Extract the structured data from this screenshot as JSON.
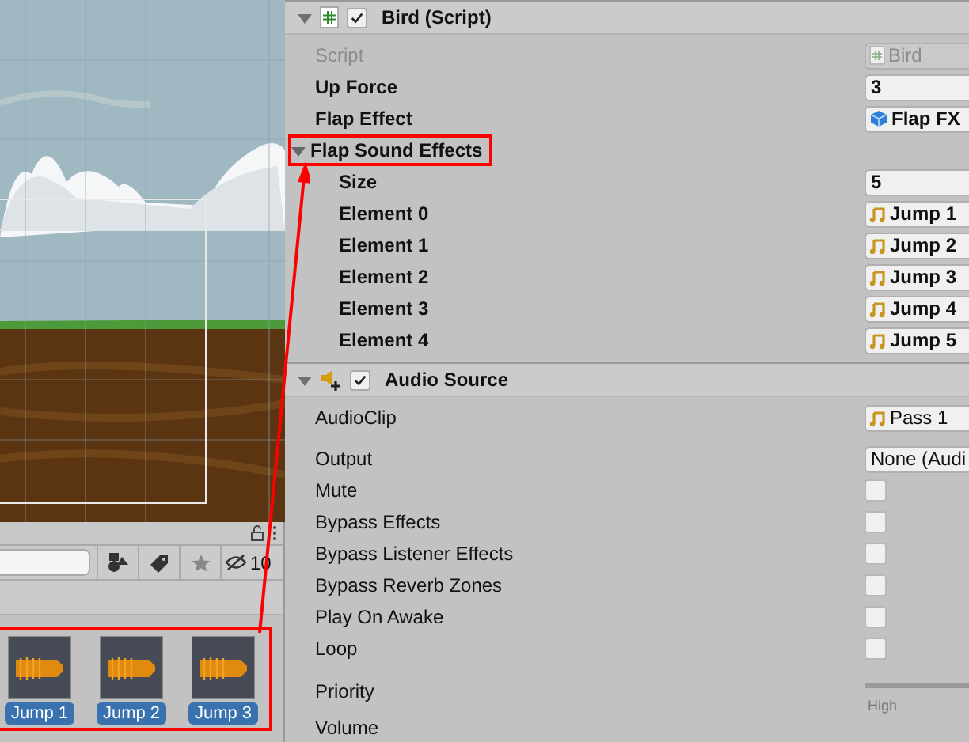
{
  "project": {
    "hidden_count": "10",
    "highlighted": true,
    "assets": [
      {
        "name": "Jump 1",
        "selected": true
      },
      {
        "name": "Jump 2",
        "selected": true
      },
      {
        "name": "Jump 3",
        "selected": true
      }
    ]
  },
  "inspector": {
    "components": [
      {
        "title": "Bird (Script)",
        "kind": "script",
        "enabled": true,
        "expanded": true,
        "fields": [
          {
            "label": "Script",
            "kind": "script_ref",
            "value": "Bird",
            "disabled": true
          },
          {
            "label": "Up Force",
            "kind": "number",
            "value": "3",
            "modified": true
          },
          {
            "label": "Flap Effect",
            "kind": "prefab_ref",
            "value": "Flap FX",
            "modified": true
          },
          {
            "label": "Flap Sound Effects",
            "kind": "foldout",
            "expanded": true,
            "modified": true,
            "highlighted": true,
            "children": [
              {
                "label": "Size",
                "kind": "number",
                "value": "5",
                "modified": true
              },
              {
                "label": "Element 0",
                "kind": "audio_ref",
                "value": "Jump 1",
                "modified": true
              },
              {
                "label": "Element 1",
                "kind": "audio_ref",
                "value": "Jump 2",
                "modified": true
              },
              {
                "label": "Element 2",
                "kind": "audio_ref",
                "value": "Jump 3",
                "modified": true
              },
              {
                "label": "Element 3",
                "kind": "audio_ref",
                "value": "Jump 4",
                "modified": true
              },
              {
                "label": "Element 4",
                "kind": "audio_ref",
                "value": "Jump 5",
                "modified": true
              }
            ]
          }
        ]
      },
      {
        "title": "Audio Source",
        "kind": "audio",
        "enabled": true,
        "expanded": true,
        "fields": [
          {
            "label": "AudioClip",
            "kind": "audio_ref",
            "value": "Pass 1"
          },
          {
            "label": "Output",
            "kind": "dropdown",
            "value": "None (Audi"
          },
          {
            "label": "Mute",
            "kind": "checkbox",
            "checked": false
          },
          {
            "label": "Bypass Effects",
            "kind": "checkbox",
            "checked": false
          },
          {
            "label": "Bypass Listener Effects",
            "kind": "checkbox",
            "checked": false
          },
          {
            "label": "Bypass Reverb Zones",
            "kind": "checkbox",
            "checked": false
          },
          {
            "label": "Play On Awake",
            "kind": "checkbox",
            "checked": false
          },
          {
            "label": "Loop",
            "kind": "checkbox",
            "checked": false
          },
          {
            "label": "Priority",
            "kind": "slider",
            "caption": "High"
          },
          {
            "label": "Volume",
            "kind": "text"
          }
        ]
      }
    ]
  }
}
